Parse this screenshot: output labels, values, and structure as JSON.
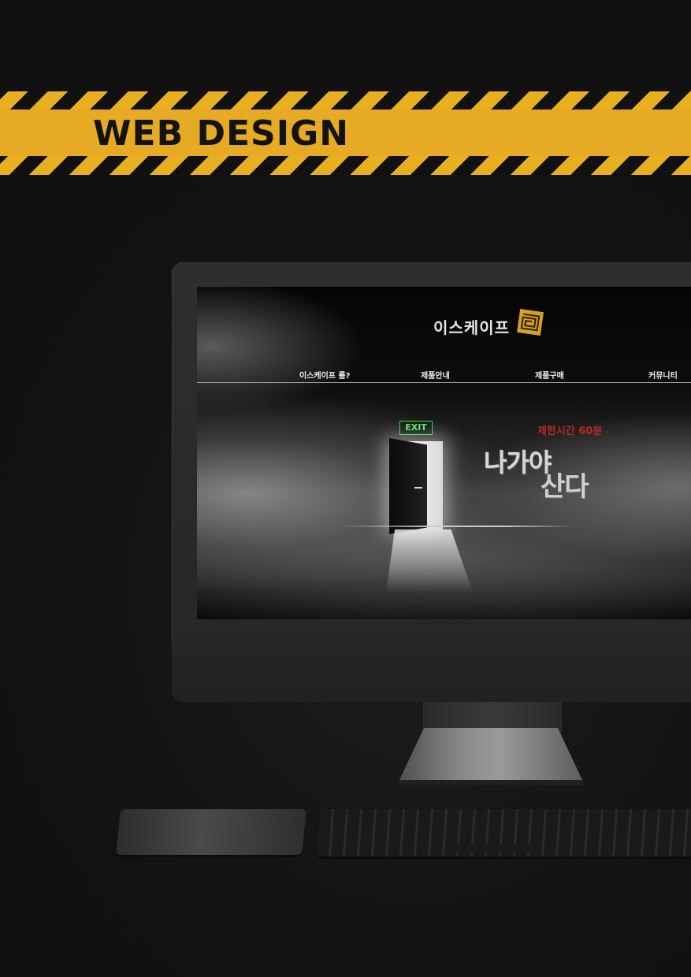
{
  "banner": {
    "title": "WEB DESIGN"
  },
  "site": {
    "logo_text": "이스케이프",
    "nav": [
      "이스케이프 룸?",
      "제품안내",
      "제품구매",
      "커뮤니티"
    ],
    "exit_sign": "EXIT",
    "time_limit": "제한시간 60분",
    "headline_1": "나가야",
    "headline_2": "산다"
  },
  "colors": {
    "tape_yellow": "#e6aa24",
    "tape_black": "#111111",
    "time_red": "#b32b24",
    "exit_green": "#5ee06a"
  }
}
